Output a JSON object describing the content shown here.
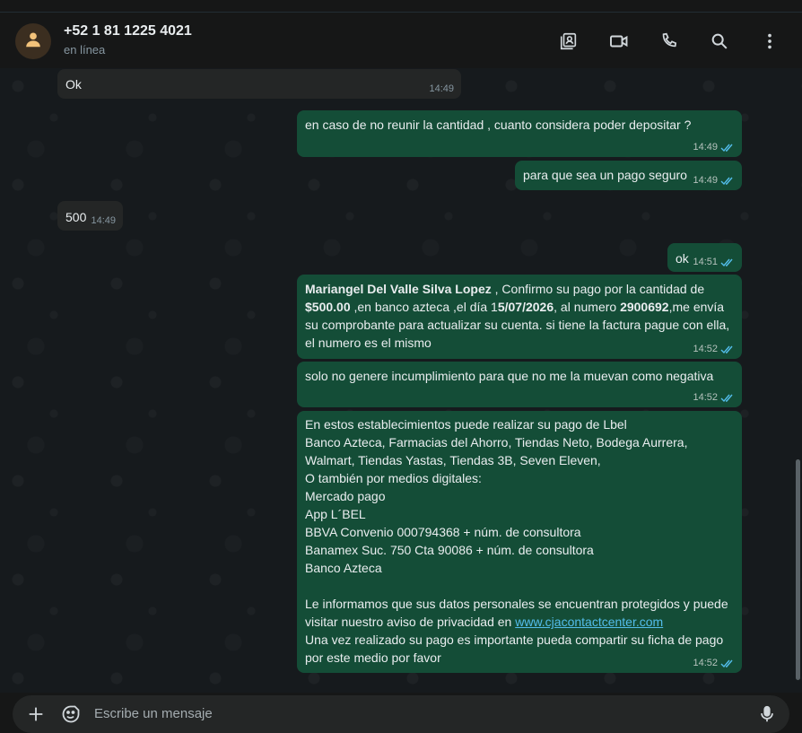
{
  "header": {
    "contact_name": "+52 1 81 1225 4021",
    "status": "en línea",
    "icons": [
      "contact-card-icon",
      "video-call-icon",
      "voice-call-icon",
      "search-icon",
      "more-options-icon"
    ]
  },
  "colors": {
    "incoming_bubble": "#242626",
    "outgoing_bubble": "#144d37",
    "read_ticks": "#53bdeb",
    "link": "#53bdeb"
  },
  "messages": [
    {
      "dir": "in",
      "text": "Ok",
      "time": "14:49"
    },
    {
      "dir": "out",
      "text": "en caso de no reunir la cantidad , cuanto considera poder depositar ?",
      "time": "14:49",
      "read": true
    },
    {
      "dir": "out",
      "text": "para que sea un pago seguro",
      "time": "14:49",
      "read": true
    },
    {
      "dir": "in",
      "text": "500",
      "time": "14:49"
    },
    {
      "dir": "out",
      "text": "ok",
      "time": "14:51",
      "read": true
    },
    {
      "dir": "out",
      "time": "14:52",
      "read": true,
      "parts": {
        "name": "Mariangel Del Valle Silva Lopez",
        "t1": " , Confirmo su  pago por la cantidad de ",
        "amount": "$500.00",
        "t2": " ,en banco azteca ,el día  1",
        "date": "5/07/2026",
        "t3": ", al numero ",
        "number": "2900692",
        "t4": ",me envía su comprobante para actualizar su cuenta. si  tiene  la factura  pague con ella,  el  numero  es el  mismo"
      }
    },
    {
      "dir": "out",
      "text": "solo no genere incumplimiento para que no me la muevan como negativa",
      "time": "14:52",
      "read": true
    },
    {
      "dir": "out",
      "time": "14:52",
      "read": true,
      "lines": [
        "En estos establecimientos puede realizar su pago de Lbel",
        "Banco Azteca, Farmacias del Ahorro, Tiendas Neto, Bodega Aurrera, Walmart, Tiendas Yastas, Tiendas 3B, Seven Eleven,",
        "O también por medios digitales:",
        "Mercado pago",
        "App L´BEL",
        "BBVA Convenio 000794368 + núm. de consultora",
        "Banamex Suc. 750 Cta 90086  + núm. de consultora",
        "Banco Azteca"
      ],
      "privacy_text": "Le informamos que sus datos personales se encuentran protegidos y puede visitar nuestro aviso de privacidad en ",
      "link": "www.cjacontactcenter.com",
      "closing": "Una vez realizado su pago es importante pueda compartir su ficha de pago por este medio por favor"
    }
  ],
  "composer": {
    "placeholder": "Escribe un mensaje",
    "icons": [
      "attach-plus-icon",
      "sticker-icon",
      "microphone-icon"
    ]
  }
}
